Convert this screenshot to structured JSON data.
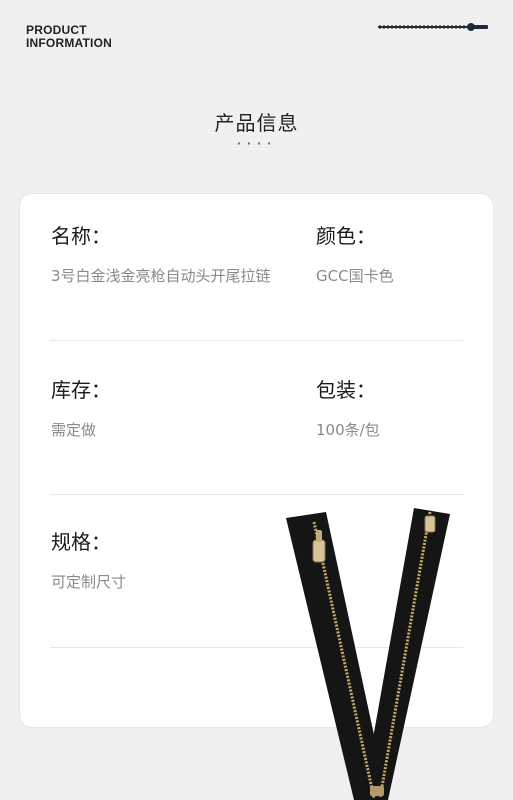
{
  "brand": {
    "line1": "PRODUCT",
    "line2": "INFORMATION"
  },
  "page_title": "产品信息",
  "title_dots": "····",
  "fields": {
    "name": {
      "label": "名称：",
      "value": "3号白金浅金亮枪自动头开尾拉链"
    },
    "color": {
      "label": "颜色：",
      "value": "GCC国卡色"
    },
    "stock": {
      "label": "库存：",
      "value": "需定做"
    },
    "packaging": {
      "label": "包装：",
      "value": "100条/包"
    },
    "spec": {
      "label": "规格：",
      "value": "可定制尺寸"
    }
  },
  "colors": {
    "background": "#f0f0f0",
    "card": "#ffffff",
    "zipper_tape": "#151515",
    "zipper_teeth": "#c9a86a"
  },
  "icons": [
    "zipper-decoration-icon",
    "zipper-product-image"
  ]
}
